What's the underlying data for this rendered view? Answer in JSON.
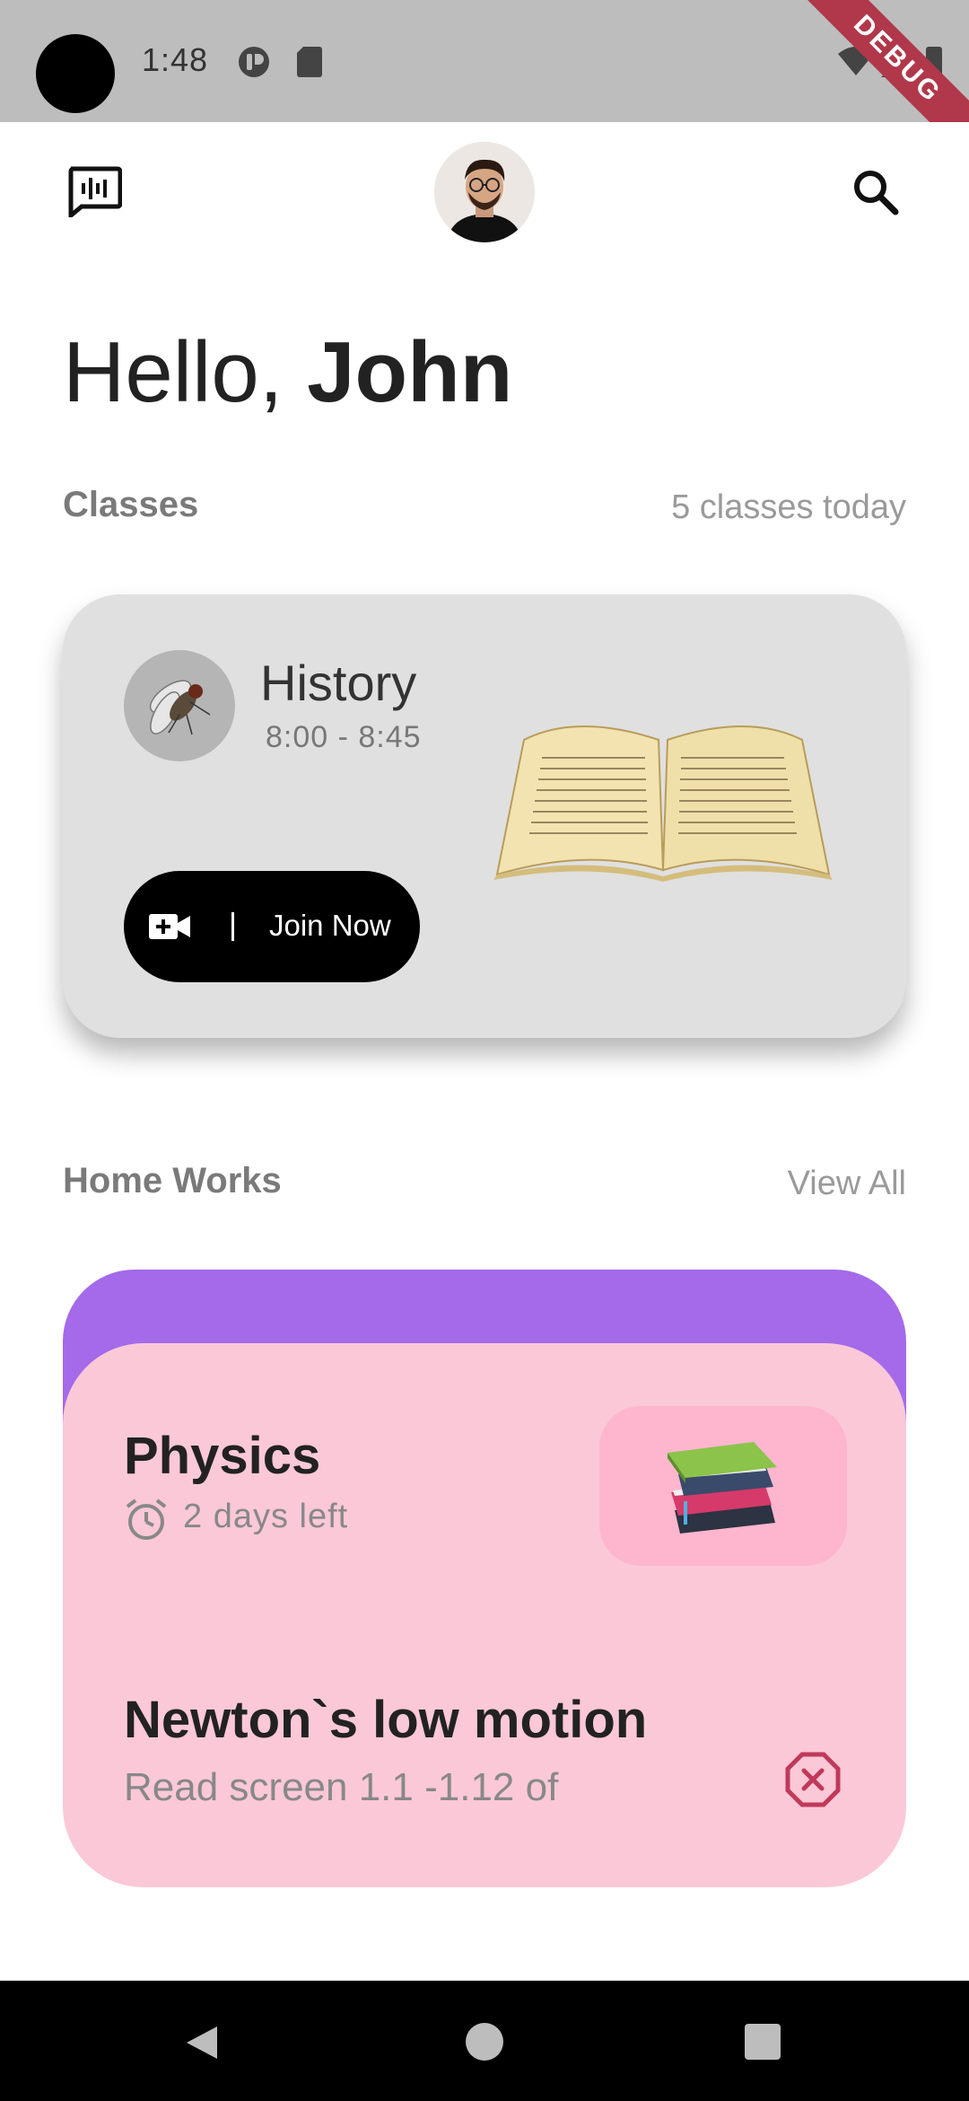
{
  "status_bar": {
    "time": "1:48",
    "debug_label": "DEBUG"
  },
  "app_bar": {
    "left_icon": "voice-chat-icon",
    "right_icon": "search-icon"
  },
  "greeting": {
    "hello": "Hello, ",
    "name": "John"
  },
  "classes_section": {
    "title": "Classes",
    "meta": "5 classes today"
  },
  "class_card": {
    "subject": "History",
    "time": "8:00 - 8:45",
    "join_label": "Join Now",
    "join_icon": "video-add-icon"
  },
  "homeworks_section": {
    "title": "Home Works",
    "view_all": "View All"
  },
  "homework_card": {
    "subject": "Physics",
    "deadline": "2 days left",
    "task_title": "Newton`s low motion",
    "task_desc": "Read screen 1.1 -1.12 of"
  },
  "colors": {
    "status_bar": "#bdbdbd",
    "class_card": "#e0e0e0",
    "homework_back": "#a46ae9",
    "homework_card": "#fbc8d8",
    "homework_thumb": "#fdb6ce",
    "accent_close": "#c0395a",
    "debug_ribbon": "#b0384a"
  }
}
